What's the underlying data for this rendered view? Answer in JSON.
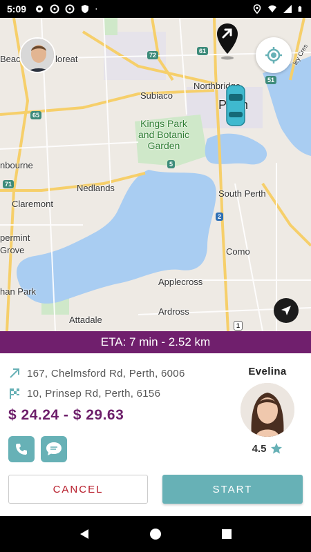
{
  "status_bar": {
    "time": "5:09",
    "left_icons": [
      "gear-icon",
      "steering-wheel-icon",
      "steering-wheel-icon",
      "shield-icon",
      "dot-icon"
    ],
    "right_icons": [
      "location-icon",
      "wifi-icon",
      "signal-icon",
      "battery-icon"
    ]
  },
  "map": {
    "labels": {
      "beaconsfield": "Beac",
      "wembley": "loreat",
      "northbridge": "Northbridge",
      "perth": "Perth",
      "subiaco": "Subiaco",
      "kings_park": "Kings Park\nand Botanic\nGarden",
      "mosman": "nbourne",
      "nedlands": "Nedlands",
      "claremont": "Claremont",
      "south_perth": "South Perth",
      "peppermint": "permint\nGrove",
      "como": "Como",
      "applecross": "Applecross",
      "freshwater": "han Park",
      "ardross": "Ardross",
      "attadale": "Attadale",
      "bayswater": "ley Cres"
    },
    "shields": {
      "r72": "72",
      "r61": "61",
      "r51": "51",
      "r65": "65",
      "r5": "5",
      "r71": "71",
      "r2": "2",
      "r1": "1"
    }
  },
  "eta": "ETA: 7 min - 2.52 km",
  "trip": {
    "pickup": "167, Chelmsford Rd, Perth, 6006",
    "dropoff": "10, Prinsep Rd, Perth, 6156",
    "price": "$ 24.24 - $ 29.63"
  },
  "rider": {
    "name": "Evelina",
    "rating": "4.5"
  },
  "buttons": {
    "cancel": "CANCEL",
    "start": "START"
  },
  "colors": {
    "accent_purple": "#701f6d",
    "accent_teal": "#67b1b6",
    "cancel_red": "#b71c2a"
  }
}
